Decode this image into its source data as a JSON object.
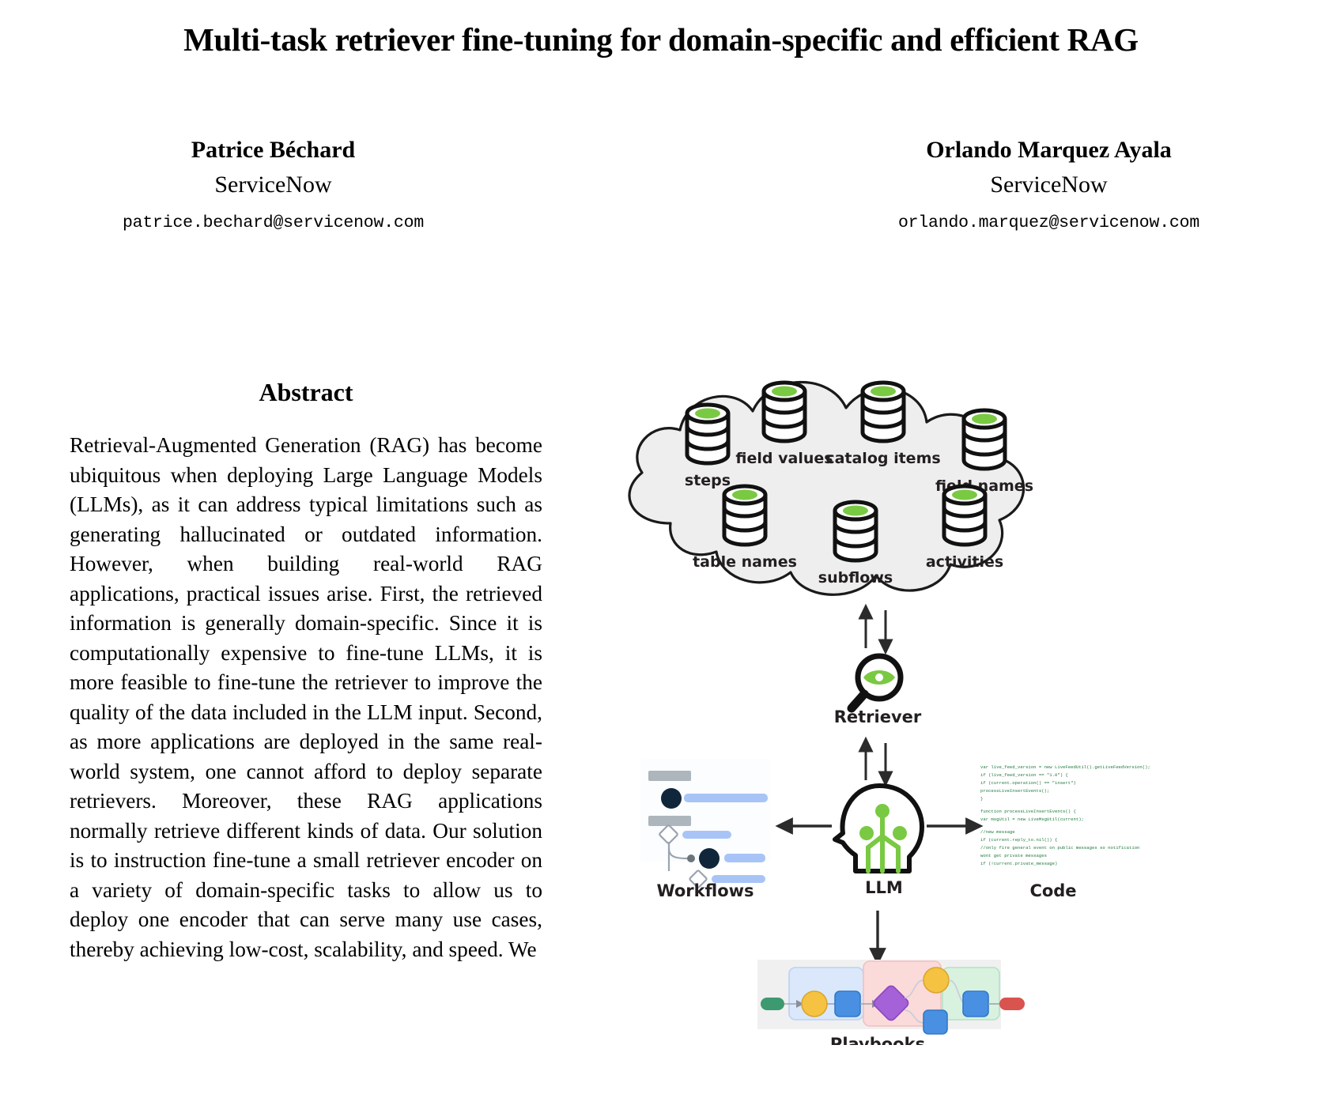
{
  "paper": {
    "title": "Multi-task retriever fine-tuning for domain-specific and efficient RAG"
  },
  "authors": [
    {
      "name": "Patrice Béchard",
      "affiliation": "ServiceNow",
      "email": "patrice.bechard@servicenow.com"
    },
    {
      "name": "Orlando Marquez Ayala",
      "affiliation": "ServiceNow",
      "email": "orlando.marquez@servicenow.com"
    }
  ],
  "abstract": {
    "heading": "Abstract",
    "body": "Retrieval-Augmented Generation (RAG) has become ubiquitous when deploying Large Language Models (LLMs), as it can address typical limitations such as generating hallucinated or outdated information.  However, when building real-world RAG applications, practical issues arise.  First, the retrieved information is generally domain-specific. Since it is computationally expensive to fine-tune LLMs, it is more feasible to fine-tune the retriever to improve the quality of the data included in the LLM input. Second, as more applications are deployed in the same real-world system, one cannot afford to deploy separate retrievers. Moreover, these RAG applications normally retrieve different kinds of data. Our solution is to instruction fine-tune a small retriever encoder on a variety of domain-specific tasks to allow us to deploy one encoder that can serve many use cases, thereby achieving low-cost, scalability, and speed. We"
  },
  "figure": {
    "cloud_databases": [
      {
        "label": "steps"
      },
      {
        "label": "field values"
      },
      {
        "label": "catalog items"
      },
      {
        "label": "field names"
      },
      {
        "label": "table names"
      },
      {
        "label": "subflows"
      },
      {
        "label": "activities"
      }
    ],
    "nodes": [
      {
        "id": "retriever",
        "label": "Retriever"
      },
      {
        "id": "llm",
        "label": "LLM"
      },
      {
        "id": "workflows",
        "label": "Workflows"
      },
      {
        "id": "code",
        "label": "Code"
      },
      {
        "id": "playbooks",
        "label": "Playbooks"
      }
    ],
    "code_snippet_lines": [
      "var live_feed_version = new LiveFeedUtil().getLiveFeedVersion();",
      "if (live_feed_version == \"1.0\") {",
      "    if (current.operation() == \"insert\")",
      "        processLiveInsertEvents();",
      "}",
      "",
      "function processLiveInsertEvents() {",
      "    var msgUtil = new LiveMsgUtil(current);",
      "",
      "    //new message",
      "    if (current.reply_to.nil()) {",
      "        //only fire general event on public messages so notification",
      "wont get private messages",
      "        if (!current.private_message)"
    ],
    "colors": {
      "cloud_fill": "#efeeee",
      "cloud_stroke": "#1a1a1a",
      "db_green": "#7ac943",
      "db_body": "#ffffff",
      "db_stroke": "#111111",
      "arrow": "#2b2b2b",
      "code_text": "#1f7a3d",
      "workflow_panel": "#fbfdff",
      "workflow_bar": "#adb5bd",
      "workflow_node_dark": "#10263b",
      "workflow_line": "#a8c4f7",
      "playbook_bg": "#f0f0f0",
      "playbook_blue_box": "#dbe8fb",
      "playbook_pink_box": "#fbdada",
      "playbook_green_box": "#d9f2e0",
      "playbook_green_pill": "#3d9970",
      "playbook_red_pill": "#d9534f",
      "playbook_yellow": "#f5c242",
      "playbook_blue": "#4a90e2",
      "playbook_purple": "#a461d8"
    }
  }
}
